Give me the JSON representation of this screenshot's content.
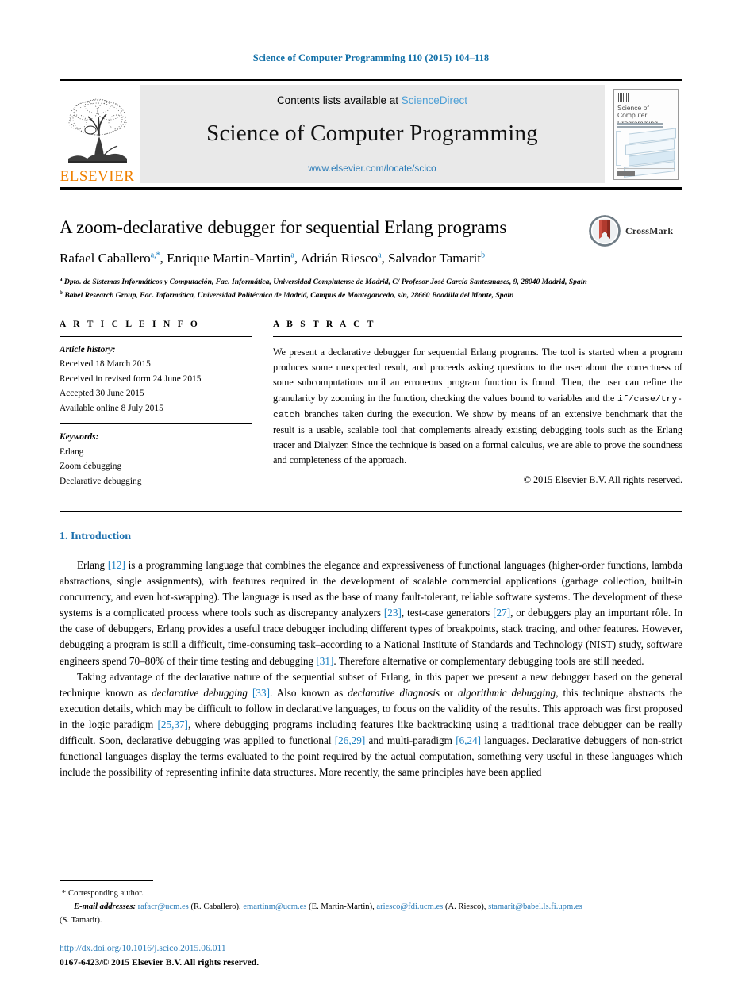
{
  "running_head": "Science of Computer Programming 110 (2015) 104–118",
  "masthead": {
    "publisher_logo_label": "ELSEVIER",
    "contents_prefix": "Contents lists available at ",
    "contents_link": "ScienceDirect",
    "journal_title": "Science of Computer Programming",
    "journal_url": "www.elsevier.com/locate/scico",
    "cover": {
      "title_line1": "Science of Computer",
      "title_line2": "Programming"
    }
  },
  "article": {
    "title": "A zoom-declarative debugger for sequential Erlang programs",
    "crossmark_label": "CrossMark",
    "authors": [
      {
        "name": "Rafael Caballero",
        "marks": "a,*"
      },
      {
        "name": "Enrique Martin-Martin",
        "marks": "a"
      },
      {
        "name": "Adrián Riesco",
        "marks": "a"
      },
      {
        "name": "Salvador Tamarit",
        "marks": "b"
      }
    ],
    "affiliations": [
      {
        "mark": "a",
        "text": "Dpto. de Sistemas Informáticos y Computación, Fac. Informática, Universidad Complutense de Madrid, C/ Profesor José García Santesmases, 9, 28040 Madrid, Spain"
      },
      {
        "mark": "b",
        "text": "Babel Research Group, Fac. Informática, Universidad Politécnica de Madrid, Campus de Montegancedo, s/n, 28660 Boadilla del Monte, Spain"
      }
    ]
  },
  "info": {
    "heading": "A R T I C L E   I N F O",
    "history_label": "Article history:",
    "history": [
      "Received 18 March 2015",
      "Received in revised form 24 June 2015",
      "Accepted 30 June 2015",
      "Available online 8 July 2015"
    ],
    "keywords_label": "Keywords:",
    "keywords": [
      "Erlang",
      "Zoom debugging",
      "Declarative debugging"
    ]
  },
  "abstract": {
    "heading": "A B S T R A C T",
    "part1": "We present a declarative debugger for sequential Erlang programs. The tool is started when a program produces some unexpected result, and proceeds asking questions to the user about the correctness of some subcomputations until an erroneous program function is found. Then, the user can refine the granularity by zooming in the function, checking the values bound to variables and the ",
    "code": "if/case/try-catch",
    "part2": " branches taken during the execution. We show by means of an extensive benchmark that the result is a usable, scalable tool that complements already existing debugging tools such as the Erlang tracer and Dialyzer. Since the technique is based on a formal calculus, we are able to prove the soundness and completeness of the approach.",
    "copyright": "© 2015 Elsevier B.V. All rights reserved."
  },
  "body": {
    "section_number_title": "1. Introduction",
    "paragraph1": {
      "s1": "Erlang ",
      "r1": "[12]",
      "s2": " is a programming language that combines the elegance and expressiveness of functional languages (higher-order functions, lambda abstractions, single assignments), with features required in the development of scalable commercial applications (garbage collection, built-in concurrency, and even hot-swapping). The language is used as the base of many fault-tolerant, reliable software systems. The development of these systems is a complicated process where tools such as discrepancy analyzers ",
      "r2": "[23]",
      "s3": ", test-case generators ",
      "r3": "[27]",
      "s4": ", or debuggers play an important rôle. In the case of debuggers, Erlang provides a useful trace debugger including different types of breakpoints, stack tracing, and other features. However, debugging a program is still a difficult, time-consuming task–according to a National Institute of Standards and Technology (NIST) study, software engineers spend 70–80% of their time testing and debugging ",
      "r4": "[31]",
      "s5": ". Therefore alternative or complementary debugging tools are still needed."
    },
    "paragraph2": {
      "s1": "Taking advantage of the declarative nature of the sequential subset of Erlang, in this paper we present a new debugger based on the general technique known as ",
      "i1": "declarative debugging",
      "s2": " ",
      "r1": "[33]",
      "s3": ". Also known as ",
      "i2": "declarative diagnosis",
      "s4": " or ",
      "i3": "algorithmic debugging",
      "s5": ", this technique abstracts the execution details, which may be difficult to follow in declarative languages, to focus on the validity of the results. This approach was first proposed in the logic paradigm ",
      "r2": "[25,37]",
      "s6": ", where debugging programs including features like backtracking using a traditional trace debugger can be really difficult. Soon, declarative debugging was applied to functional ",
      "r3": "[26,29]",
      "s7": " and multi-paradigm ",
      "r4": "[6,24]",
      "s8": " languages. Declarative debuggers of non-strict functional languages display the terms evaluated to the point required by the actual computation, something very useful in these languages which include the possibility of representing infinite data structures. More recently, the same principles have been applied"
    }
  },
  "footnotes": {
    "corresponding": "Corresponding author.",
    "email_label": "E-mail addresses:",
    "emails": [
      {
        "address": "rafacr@ucm.es",
        "owner": " (R. Caballero), "
      },
      {
        "address": "emartinm@ucm.es",
        "owner": " (E. Martin-Martin), "
      },
      {
        "address": "ariesco@fdi.ucm.es",
        "owner": " (A. Riesco), "
      },
      {
        "address": "stamarit@babel.ls.fi.upm.es",
        "owner": ""
      }
    ],
    "email_tail": "(S. Tamarit)."
  },
  "footer": {
    "doi": "http://dx.doi.org/10.1016/j.scico.2015.06.011",
    "issn_line": "0167-6423/© 2015 Elsevier B.V. All rights reserved."
  },
  "colors": {
    "link_blue": "#2b7cb8",
    "ref_blue": "#1a7fc1",
    "heading_blue": "#1a6fae",
    "elsevier_orange": "#f08000",
    "masthead_gray": "#e9e9e9"
  }
}
